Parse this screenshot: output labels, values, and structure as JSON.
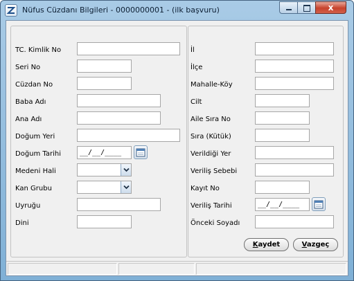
{
  "window": {
    "title": "Nüfus Cüzdanı Bilgileri - 0000000001 - (ilk başvuru)",
    "controls": {
      "close_glyph": "x"
    }
  },
  "left_form": {
    "tc_kimlik_no": {
      "label": "TC. Kimlik No",
      "value": ""
    },
    "seri_no": {
      "label": "Seri No",
      "value": ""
    },
    "cuzdan_no": {
      "label": "Cüzdan No",
      "value": ""
    },
    "baba_adi": {
      "label": "Baba Adı",
      "value": ""
    },
    "ana_adi": {
      "label": "Ana Adı",
      "value": ""
    },
    "dogum_yeri": {
      "label": "Doğum Yeri",
      "value": ""
    },
    "dogum_tarihi": {
      "label": "Doğum Tarihi",
      "value": "__/__/____"
    },
    "medeni_hali": {
      "label": "Medeni Hali",
      "value": ""
    },
    "kan_grubu": {
      "label": "Kan Grubu",
      "value": ""
    },
    "uyrugu": {
      "label": "Uyruğu",
      "value": ""
    },
    "dini": {
      "label": "Dini",
      "value": ""
    }
  },
  "right_form": {
    "il": {
      "label": "İl",
      "value": ""
    },
    "ilce": {
      "label": "İlçe",
      "value": ""
    },
    "mahalle_koy": {
      "label": "Mahalle-Köy",
      "value": ""
    },
    "cilt": {
      "label": "Cilt",
      "value": ""
    },
    "aile_sira_no": {
      "label": "Aile Sıra No",
      "value": ""
    },
    "sira_kutuk": {
      "label": "Sıra (Kütük)",
      "value": ""
    },
    "verildigi_yer": {
      "label": "Verildiği Yer",
      "value": ""
    },
    "verilis_sebebi": {
      "label": "Veriliş Sebebi",
      "value": ""
    },
    "kayit_no": {
      "label": "Kayıt No",
      "value": ""
    },
    "verilis_tarihi": {
      "label": "Veriliş Tarihi",
      "value": "__/__/____"
    },
    "onceki_soyadi": {
      "label": "Önceki Soyadı",
      "value": ""
    }
  },
  "actions": {
    "save": {
      "accel": "K",
      "rest": "aydet"
    },
    "cancel": {
      "accel": "V",
      "rest": "azgeç"
    }
  },
  "icons": {
    "app": "app-logo-icon",
    "calendar": "calendar-icon",
    "dropdown": "chevron-down-icon"
  }
}
